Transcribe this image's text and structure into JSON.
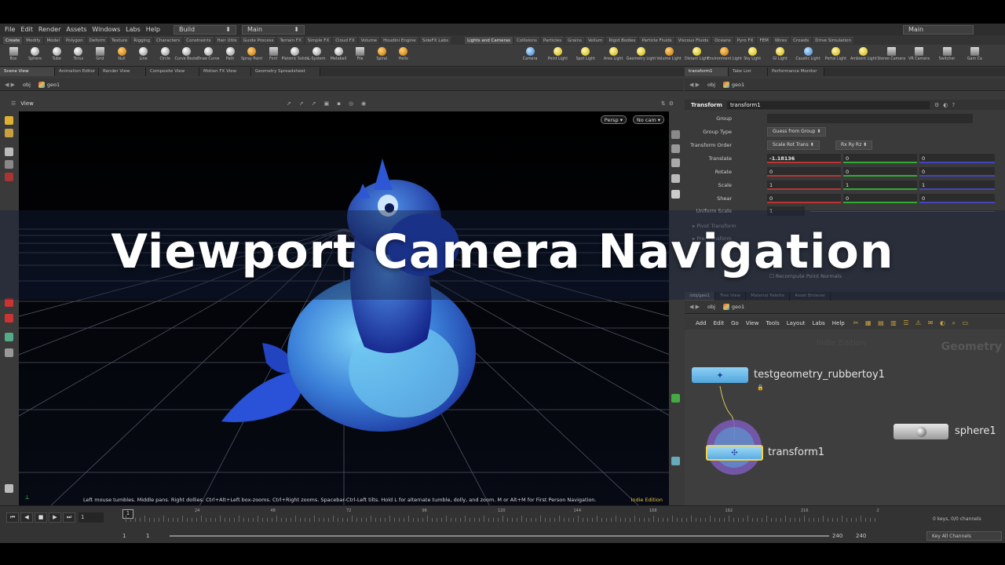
{
  "menubar": {
    "items": [
      "File",
      "Edit",
      "Render",
      "Assets",
      "Windows",
      "Labs",
      "Help"
    ],
    "desktop": "Build",
    "workspace": "Main",
    "workspace_right": "Main"
  },
  "shelf_tabs_left": [
    "Create",
    "Modify",
    "Model",
    "Polygon",
    "Deform",
    "Texture",
    "Rigging",
    "Characters",
    "Constraints",
    "Hair Utils",
    "Guide Process",
    "Terrain FX",
    "Simple FX",
    "Cloud FX",
    "Volume",
    "Houdini Engine",
    "SideFX Labs"
  ],
  "shelf_tabs_right": [
    "Lights and Cameras",
    "Collisions",
    "Particles",
    "Grains",
    "Vellum",
    "Rigid Bodies",
    "Particle Fluids",
    "Viscous Fluids",
    "Oceans",
    "Pyro FX",
    "FEM",
    "Wires",
    "Crowds",
    "Drive Simulation"
  ],
  "shelf_tools_left": [
    "Box",
    "Sphere",
    "Tube",
    "Torus",
    "Grid",
    "Null",
    "Line",
    "Circle",
    "Curve Bezier",
    "Draw Curve",
    "Path",
    "Spray Paint",
    "Font",
    "Platonic Solids",
    "L-System",
    "Metaball",
    "File",
    "Spiral",
    "Helix"
  ],
  "shelf_tools_right": [
    "Camera",
    "Point Light",
    "Spot Light",
    "Area Light",
    "Geometry Light",
    "Volume Light",
    "Distant Light",
    "Environment Light",
    "Sky Light",
    "GI Light",
    "Caustic Light",
    "Portal Light",
    "Ambient Light",
    "Stereo Camera",
    "VR Camera",
    "Switcher",
    "Gam Ca"
  ],
  "pane_tabs_left": [
    "Scene View",
    "Animation Editor",
    "Render View",
    "Composite View",
    "Motion FX View",
    "Geometry Spreadsheet"
  ],
  "pane_tabs_right": [
    "transform1",
    "Take List",
    "Performance Monitor"
  ],
  "path": {
    "obj": "obj",
    "geo": "geo1"
  },
  "viewport": {
    "label": "View",
    "persp": "Persp",
    "cam": "No cam",
    "hint": "Left mouse tumbles. Middle pans. Right dollies. Ctrl+Alt+Left box-zooms. Ctrl+Right zooms. Spacebar-Ctrl-Left tilts. Hold L for alternate tumble, dolly, and zoom.     M or Alt+M for First Person Navigation.",
    "edition": "Indie Edition"
  },
  "params": {
    "type": "Transform",
    "name": "transform1",
    "group_label": "Group",
    "group_value": "",
    "group_type_label": "Group Type",
    "group_type": "Guess from Group",
    "order_label": "Transform Order",
    "order_value": "Scale Rot Trans",
    "rot_order": "Rx Ry Rz",
    "translate_label": "Translate",
    "translate": [
      "-1.18136",
      "0",
      "0"
    ],
    "rotate_label": "Rotate",
    "rotate": [
      "0",
      "0",
      "0"
    ],
    "scale_label": "Scale",
    "scale": [
      "1",
      "1",
      "1"
    ],
    "shear_label": "Shear",
    "shear": [
      "0",
      "0",
      "0"
    ],
    "uniform_label": "Uniform Scale",
    "uniform": "1",
    "pivot": "Pivot Transform",
    "pre": "Pre-Transform",
    "recompute": "Recompute Point Normals"
  },
  "network": {
    "tabs": [
      "/obj/geo1",
      "Tree View",
      "Material Palette",
      "Asset Browser"
    ],
    "menu": [
      "Add",
      "Edit",
      "Go",
      "View",
      "Tools",
      "Layout",
      "Labs",
      "Help"
    ],
    "watermark_edition": "Indie Edition",
    "watermark_context": "Geometry",
    "nodes": [
      {
        "name": "testgeometry_rubbertoy1"
      },
      {
        "name": "transform1"
      },
      {
        "name": "sphere1"
      }
    ]
  },
  "timeline": {
    "frame": "1",
    "current_marker": "1",
    "ticks": [
      "24",
      "48",
      "72",
      "96",
      "120",
      "144",
      "168",
      "192",
      "216",
      "2"
    ],
    "start": "1",
    "start2": "1",
    "end": "240",
    "end2": "240",
    "keys": "0 keys, 0/0 channels",
    "key_all": "Key All Channels"
  },
  "overlay_title": "Viewport Camera Navigation",
  "colors": {
    "accent_blue": "#3b6fd8",
    "toy_light": "#66c8f0",
    "node_blue": "#6fb6e6",
    "node_yellow": "#f2d24a"
  }
}
